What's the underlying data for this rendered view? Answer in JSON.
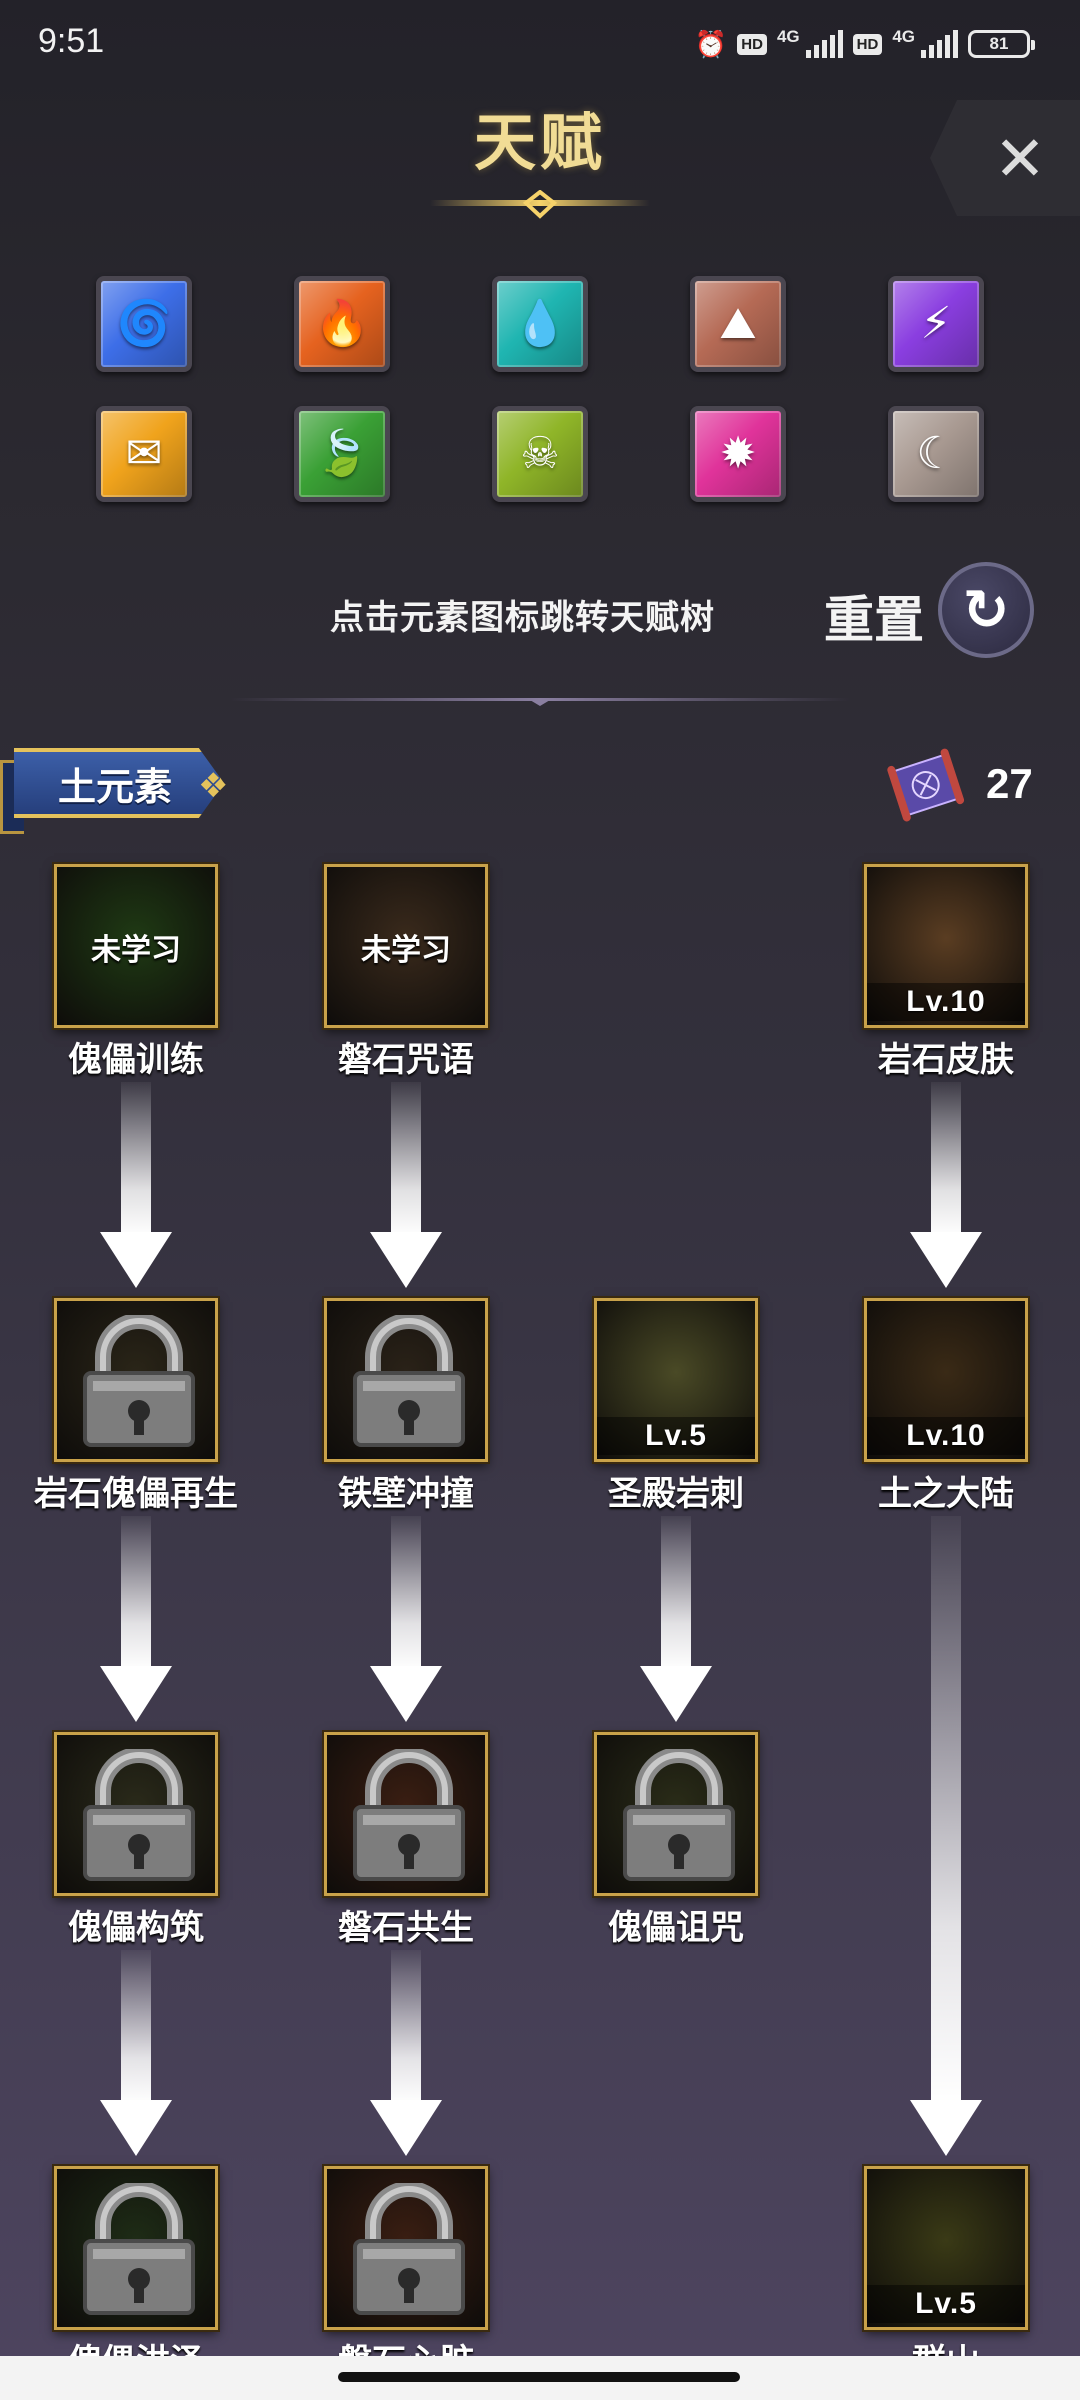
{
  "status_bar": {
    "time": "9:51",
    "icons": [
      "alarm-icon",
      "hd-icon",
      "signal-icon",
      "hd-icon",
      "signal-icon",
      "battery-icon"
    ],
    "hd_label": "HD",
    "network_label": "4G",
    "battery_level": "81"
  },
  "header": {
    "title": "天赋",
    "close_icon": "close-icon"
  },
  "elements": [
    {
      "icon": "tornado-icon",
      "glyph": "🌀",
      "color": "#3d6ee8"
    },
    {
      "icon": "fire-icon",
      "glyph": "🔥",
      "color": "#e5621f"
    },
    {
      "icon": "water-drop-icon",
      "glyph": "💧",
      "color": "#1fb5b1"
    },
    {
      "icon": "earth-cracked-icon",
      "glyph": "⛰",
      "color": "#b56a55"
    },
    {
      "icon": "lightning-icon",
      "glyph": "⚡",
      "color": "#8a3ee0"
    },
    {
      "icon": "gold-envelope-icon",
      "glyph": "✉",
      "color": "#f0a31c"
    },
    {
      "icon": "leaf-icon",
      "glyph": "🍃",
      "color": "#3aa035"
    },
    {
      "icon": "poison-skull-icon",
      "glyph": "☠",
      "color": "#8fb528"
    },
    {
      "icon": "sun-icon",
      "glyph": "✹",
      "color": "#e0339a"
    },
    {
      "icon": "moon-icon",
      "glyph": "☾",
      "color": "#a99a92"
    }
  ],
  "hint": "点击元素图标跳转天赋树",
  "reset": {
    "label": "重置",
    "icon": "reset-arrow-icon"
  },
  "current_element": {
    "label": "土元素"
  },
  "talent_points": {
    "icon": "scroll-icon",
    "count": "27"
  },
  "skills": [
    {
      "name": "傀儡训练",
      "overlay": "未学习",
      "level": "",
      "locked": false,
      "bg": "#1f3a14"
    },
    {
      "name": "磐石咒语",
      "overlay": "未学习",
      "level": "",
      "locked": false,
      "bg": "#3a2a1c"
    },
    {
      "name": "岩石皮肤",
      "overlay": "",
      "level": "Lv.10",
      "locked": false,
      "bg": "#5a3d22"
    },
    {
      "name": "岩石傀儡再生",
      "overlay": "",
      "level": "",
      "locked": true,
      "bg": "#2a2518"
    },
    {
      "name": "铁壁冲撞",
      "overlay": "",
      "level": "",
      "locked": true,
      "bg": "#2a2218"
    },
    {
      "name": "圣殿岩刺",
      "overlay": "",
      "level": "Lv.5",
      "locked": false,
      "bg": "#4a4a26"
    },
    {
      "name": "土之大陆",
      "overlay": "",
      "level": "Lv.10",
      "locked": false,
      "bg": "#3a2a16"
    },
    {
      "name": "傀儡构筑",
      "overlay": "",
      "level": "",
      "locked": true,
      "bg": "#2a2a1a"
    },
    {
      "name": "磐石共生",
      "overlay": "",
      "level": "",
      "locked": true,
      "bg": "#3a1e12"
    },
    {
      "name": "傀儡诅咒",
      "overlay": "",
      "level": "",
      "locked": true,
      "bg": "#2a2c18"
    },
    {
      "name": "傀儡洪泽",
      "overlay": "",
      "level": "",
      "locked": true,
      "bg": "#1e2c16"
    },
    {
      "name": "磐石心脏",
      "overlay": "",
      "level": "",
      "locked": true,
      "bg": "#3a1e12"
    },
    {
      "name": "群山",
      "overlay": "",
      "level": "Lv.5",
      "locked": false,
      "bg": "#3a3a16"
    }
  ]
}
